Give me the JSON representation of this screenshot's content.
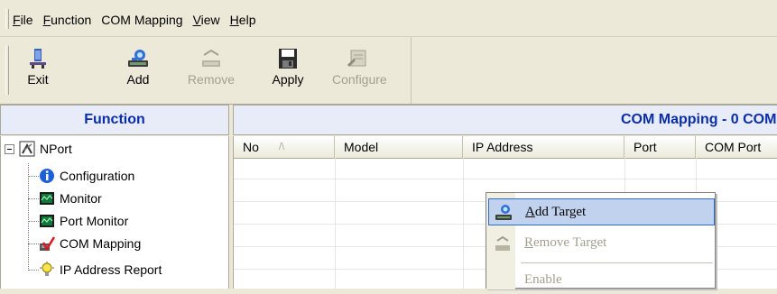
{
  "menu": {
    "items": [
      {
        "first": "F",
        "rest": "ile"
      },
      {
        "first": "F",
        "rest": "unction"
      },
      {
        "first": "",
        "rest": "COM Mapping"
      },
      {
        "first": "V",
        "rest": "iew"
      },
      {
        "first": "H",
        "rest": "elp"
      }
    ]
  },
  "toolbar": {
    "exit": "Exit",
    "add": "Add",
    "remove": "Remove",
    "apply": "Apply",
    "configure": "Configure"
  },
  "function_pane": {
    "title": "Function",
    "root": "NPort",
    "items": [
      {
        "label": "Configuration",
        "icon": "info-icon"
      },
      {
        "label": "Monitor",
        "icon": "monitor-icon"
      },
      {
        "label": "Port Monitor",
        "icon": "port-monitor-icon"
      },
      {
        "label": "COM Mapping",
        "icon": "com-mapping-icon"
      },
      {
        "label": "IP Address Report",
        "icon": "lightbulb-icon"
      }
    ]
  },
  "com_pane": {
    "title": "COM Mapping - 0 COM",
    "columns": [
      "No",
      "Model",
      "IP Address",
      "Port",
      "COM Port"
    ],
    "sort_indicator": "/\\"
  },
  "context_menu": {
    "items": [
      {
        "first": "A",
        "rest": "dd Target",
        "enabled": true
      },
      {
        "first": "R",
        "rest": "emove Target",
        "enabled": false
      },
      {
        "first": "",
        "rest": "Enable",
        "enabled": false
      }
    ]
  },
  "colors": {
    "header_text": "#0a2ea8",
    "highlight": "#c1d2ee",
    "highlight_border": "#316ac5"
  }
}
